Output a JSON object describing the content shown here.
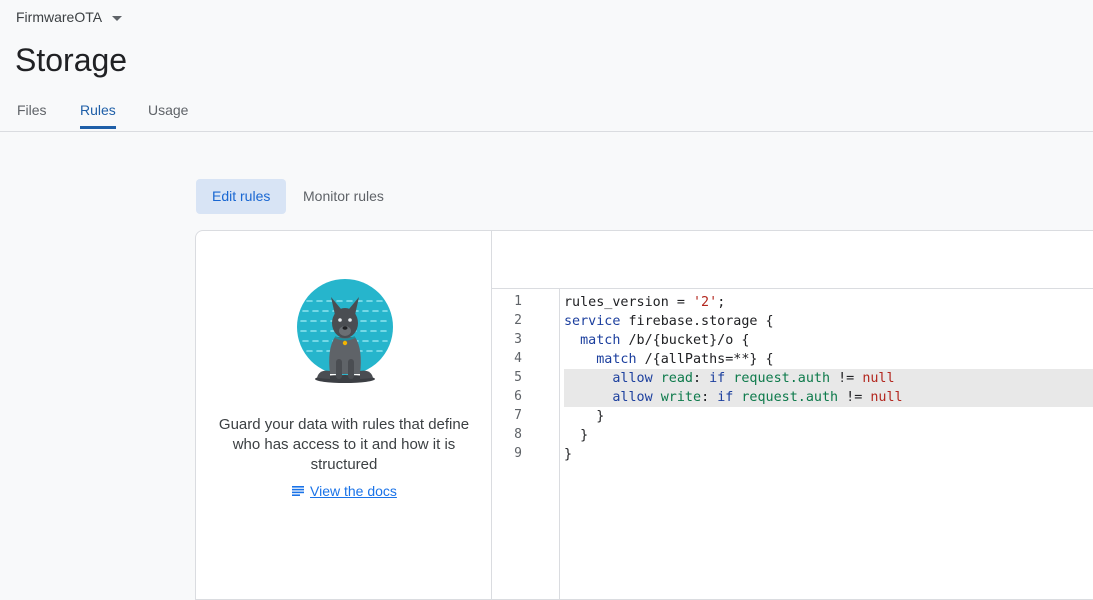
{
  "project": {
    "name": "FirmwareOTA"
  },
  "page": {
    "title": "Storage"
  },
  "tabs": [
    {
      "label": "Files"
    },
    {
      "label": "Rules"
    },
    {
      "label": "Usage"
    }
  ],
  "active_tab": "Rules",
  "segments": {
    "edit": "Edit rules",
    "monitor": "Monitor rules"
  },
  "info": {
    "description": "Guard your data with rules that define who has access to it and how it is structured",
    "docs_link": "View the docs"
  },
  "editor": {
    "line_numbers": [
      "1",
      "2",
      "3",
      "4",
      "5",
      "6",
      "7",
      "8",
      "9"
    ],
    "lines": [
      "rules_version = '2';",
      "service firebase.storage {",
      "  match /b/{bucket}/o {",
      "    match /{allPaths=**} {",
      "      allow read: if request.auth != null",
      "      allow write: if request.auth != null",
      "    }",
      "  }",
      "}"
    ],
    "highlighted_lines": [
      5,
      6
    ]
  },
  "colors": {
    "accent": "#1a73e8",
    "tab_active": "#1f5fa8",
    "segment_active_bg": "#d8e4f5"
  }
}
